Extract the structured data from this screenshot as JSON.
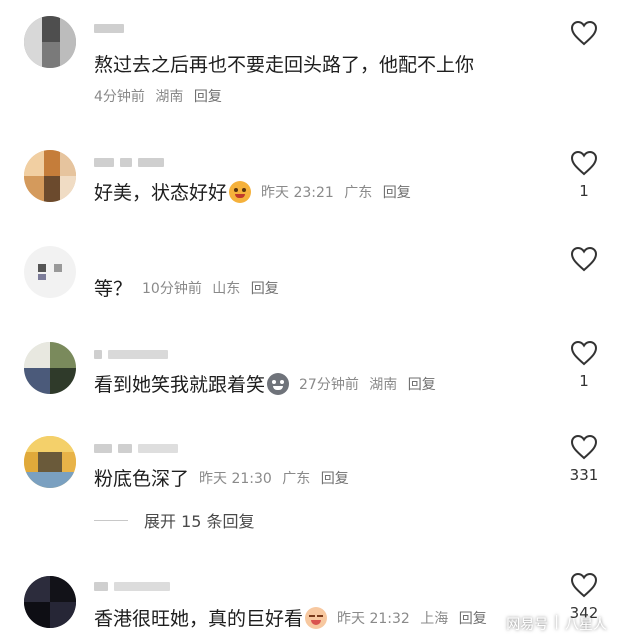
{
  "comments": [
    {
      "text": "熬过去之后再也不要走回头路了，他配不上你",
      "time": "4分钟前",
      "location": "湖南",
      "reply_label": "回复",
      "like_count": ""
    },
    {
      "text": "好美，状态好好",
      "emoji": "smiling-face-emoji",
      "time": "昨天 23:21",
      "location": "广东",
      "reply_label": "回复",
      "like_count": "1"
    },
    {
      "text": "等？",
      "time": "10分钟前",
      "location": "山东",
      "reply_label": "回复",
      "like_count": ""
    },
    {
      "text": "看到她笑我就跟着笑",
      "emoji": "grinning-face-emoji",
      "time": "27分钟前",
      "location": "湖南",
      "reply_label": "回复",
      "like_count": "1"
    },
    {
      "text": "粉底色深了",
      "time": "昨天 21:30",
      "location": "广东",
      "reply_label": "回复",
      "like_count": "331"
    },
    {
      "text": "香港很旺她，真的巨好看",
      "emoji": "laughing-face-emoji",
      "time": "昨天 21:32",
      "location": "上海",
      "reply_label": "回复",
      "like_count": "342"
    }
  ],
  "expand_replies": {
    "label": "展开 15 条回复"
  },
  "watermark": {
    "left": "网易号",
    "right": "八星人"
  },
  "colors": {
    "meta_text": "#8a8a8a",
    "body_text": "#1e1e1e",
    "heart_outline": "#333333"
  }
}
